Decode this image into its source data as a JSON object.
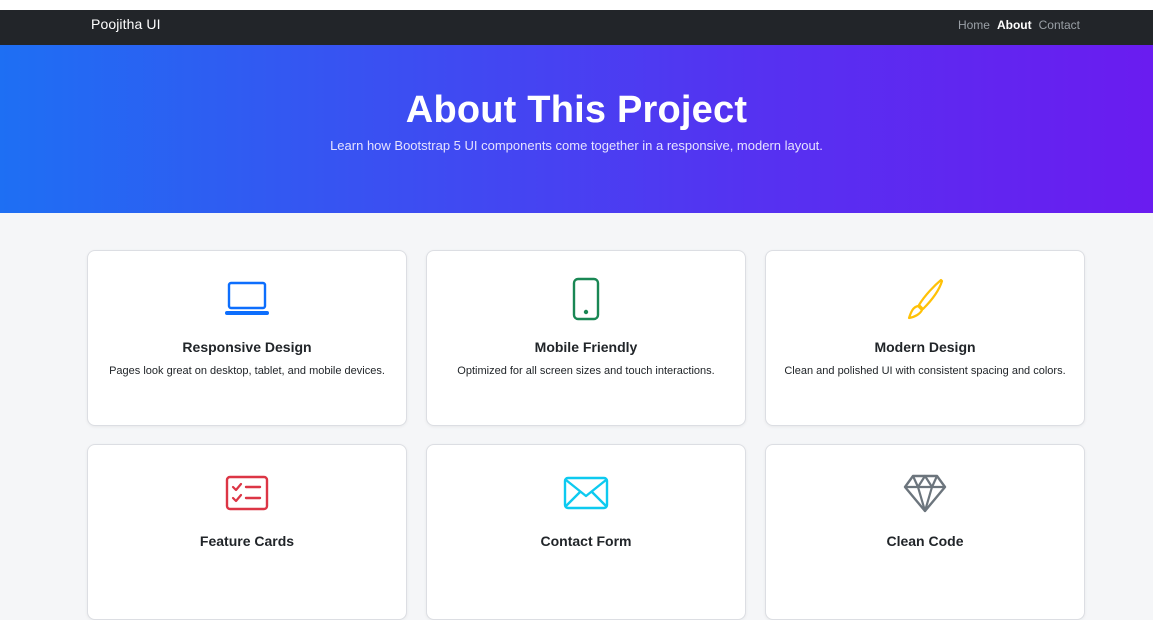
{
  "navbar": {
    "brand": "Poojitha UI",
    "links": [
      {
        "label": "Home",
        "active": false
      },
      {
        "label": "About",
        "active": true
      },
      {
        "label": "Contact",
        "active": false
      }
    ]
  },
  "hero": {
    "title": "About This Project",
    "subtitle": "Learn how Bootstrap 5 UI components come together in a responsive, modern layout."
  },
  "cards": [
    {
      "icon": "laptop-icon",
      "color": "#0d6efd",
      "title": "Responsive Design",
      "description": "Pages look great on desktop, tablet, and mobile devices."
    },
    {
      "icon": "phone-icon",
      "color": "#198754",
      "title": "Mobile Friendly",
      "description": "Optimized for all screen sizes and touch interactions."
    },
    {
      "icon": "brush-icon",
      "color": "#ffc107",
      "title": "Modern Design",
      "description": "Clean and polished UI with consistent spacing and colors."
    },
    {
      "icon": "checklist-icon",
      "color": "#dc3545",
      "title": "Feature Cards",
      "description": ""
    },
    {
      "icon": "envelope-icon",
      "color": "#0dcaf0",
      "title": "Contact Form",
      "description": ""
    },
    {
      "icon": "gem-icon",
      "color": "#6c757d",
      "title": "Clean Code",
      "description": ""
    }
  ]
}
